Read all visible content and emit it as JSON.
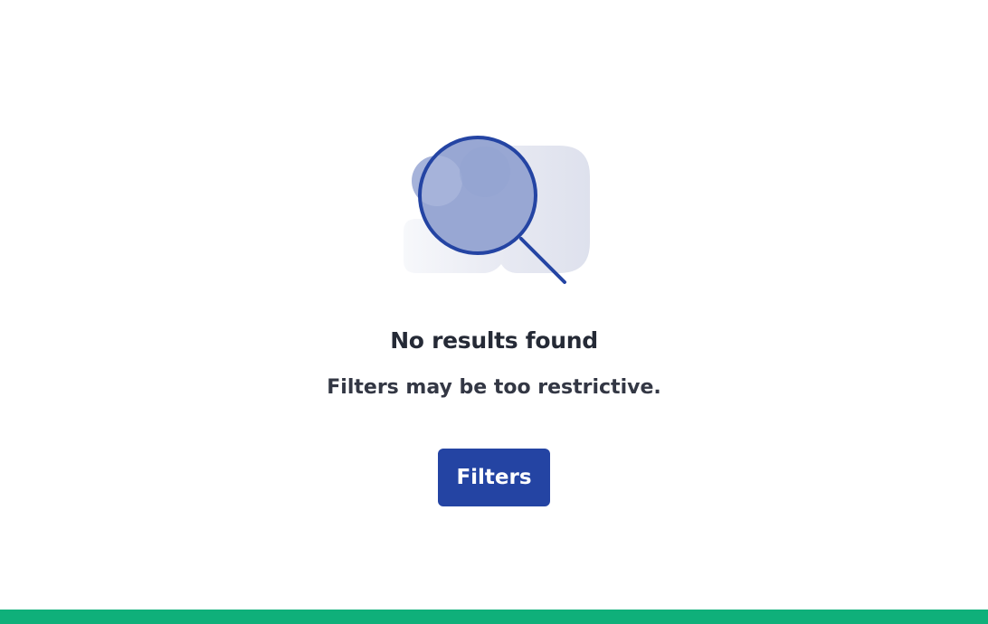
{
  "empty_state": {
    "title": "No results found",
    "subtitle": "Filters may be too restrictive.",
    "illustration_icon": "magnifying-glass-icon"
  },
  "actions": {
    "filters_label": "Filters"
  },
  "colors": {
    "primary": "#2444a3",
    "accent_bar": "#0fb07a",
    "title_text": "#252a36"
  }
}
